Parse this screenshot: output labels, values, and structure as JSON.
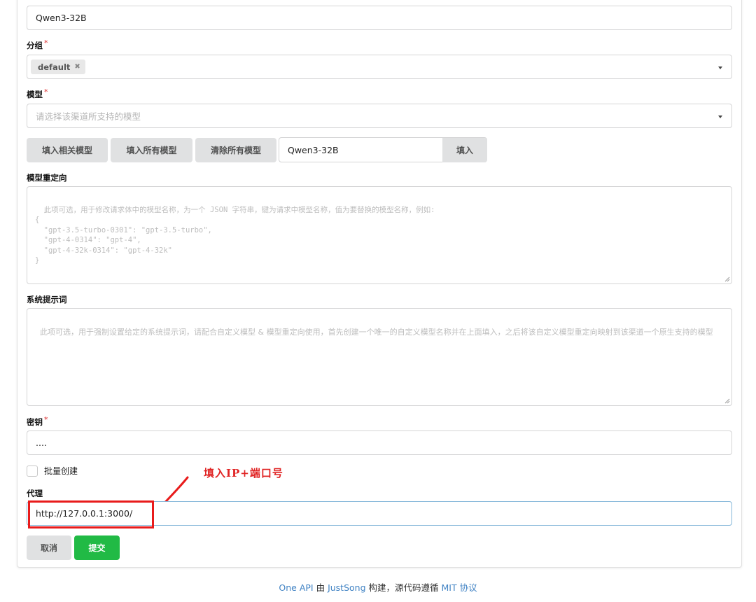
{
  "name_field": {
    "value": "Qwen3-32B"
  },
  "group": {
    "label": "分组",
    "required_mark": "*",
    "chip": "default",
    "chip_remove_glyph": "✖"
  },
  "models": {
    "label": "模型",
    "required_mark": "*",
    "placeholder": "请选择该渠道所支持的模型",
    "buttons": {
      "fill_related": "填入相关模型",
      "fill_all": "填入所有模型",
      "clear_all": "清除所有模型",
      "fill": "填入"
    },
    "custom_input_value": "Qwen3-32B"
  },
  "model_mapping": {
    "label": "模型重定向",
    "placeholder": "此项可选，用于修改请求体中的模型名称，为一个 JSON 字符串，键为请求中模型名称，值为要替换的模型名称，例如:\n{\n  \"gpt-3.5-turbo-0301\": \"gpt-3.5-turbo\",\n  \"gpt-4-0314\": \"gpt-4\",\n  \"gpt-4-32k-0314\": \"gpt-4-32k\"\n}"
  },
  "system_prompt": {
    "label": "系统提示词",
    "placeholder": "此项可选，用于强制设置给定的系统提示词，请配合自定义模型 & 模型重定向使用，首先创建一个唯一的自定义模型名称并在上面填入，之后将该自定义模型重定向映射到该渠道一个原生支持的模型"
  },
  "key": {
    "label": "密钥",
    "required_mark": "*",
    "value": "...."
  },
  "batch": {
    "label": "批量创建"
  },
  "proxy": {
    "label": "代理",
    "value": "http://127.0.0.1:3000/"
  },
  "annotation": {
    "text": "填入IP+端口号",
    "color": "#e02424"
  },
  "actions": {
    "cancel": "取消",
    "submit": "提交"
  },
  "footer": {
    "project": "One API",
    "by": " 由 ",
    "author": "JustSong",
    "mid": " 构建，源代码遵循 ",
    "license": "MIT 协议"
  }
}
